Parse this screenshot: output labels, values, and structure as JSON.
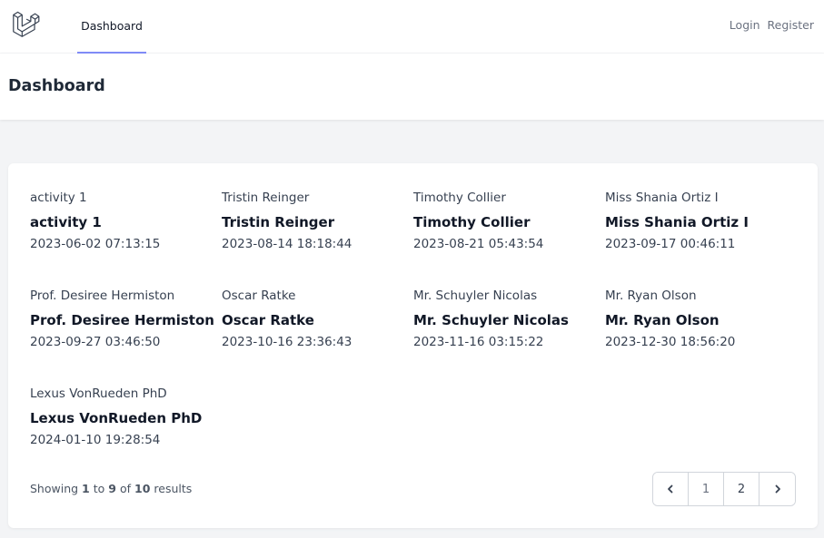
{
  "nav": {
    "logo_icon": "laravel-logo-icon",
    "dashboard_link": "Dashboard",
    "login": "Login",
    "register": "Register"
  },
  "header": {
    "title": "Dashboard"
  },
  "items": [
    {
      "label": "activity 1",
      "name": "activity 1",
      "date": "2023-06-02 07:13:15"
    },
    {
      "label": "Tristin Reinger",
      "name": "Tristin Reinger",
      "date": "2023-08-14 18:18:44"
    },
    {
      "label": "Timothy Collier",
      "name": "Timothy Collier",
      "date": "2023-08-21 05:43:54"
    },
    {
      "label": "Miss Shania Ortiz I",
      "name": "Miss Shania Ortiz I",
      "date": "2023-09-17 00:46:11"
    },
    {
      "label": "Prof. Desiree Hermiston",
      "name": "Prof. Desiree Hermiston",
      "date": "2023-09-27 03:46:50"
    },
    {
      "label": "Oscar Ratke",
      "name": "Oscar Ratke",
      "date": "2023-10-16 23:36:43"
    },
    {
      "label": "Mr. Schuyler Nicolas",
      "name": "Mr. Schuyler Nicolas",
      "date": "2023-11-16 03:15:22"
    },
    {
      "label": "Mr. Ryan Olson",
      "name": "Mr. Ryan Olson",
      "date": "2023-12-30 18:56:20"
    },
    {
      "label": "Lexus VonRueden PhD",
      "name": "Lexus VonRueden PhD",
      "date": "2024-01-10 19:28:54"
    }
  ],
  "pagination": {
    "showing_text": "Showing",
    "from": "1",
    "to_text": "to",
    "to": "9",
    "of_text": "of",
    "total": "10",
    "results_text": "results",
    "prev_icon": "chevron-left-icon",
    "next_icon": "chevron-right-icon",
    "pages": [
      "1",
      "2"
    ],
    "current_page": "1"
  },
  "colors": {
    "accent_underline": "#818cf8",
    "background": "#f3f4f6"
  }
}
